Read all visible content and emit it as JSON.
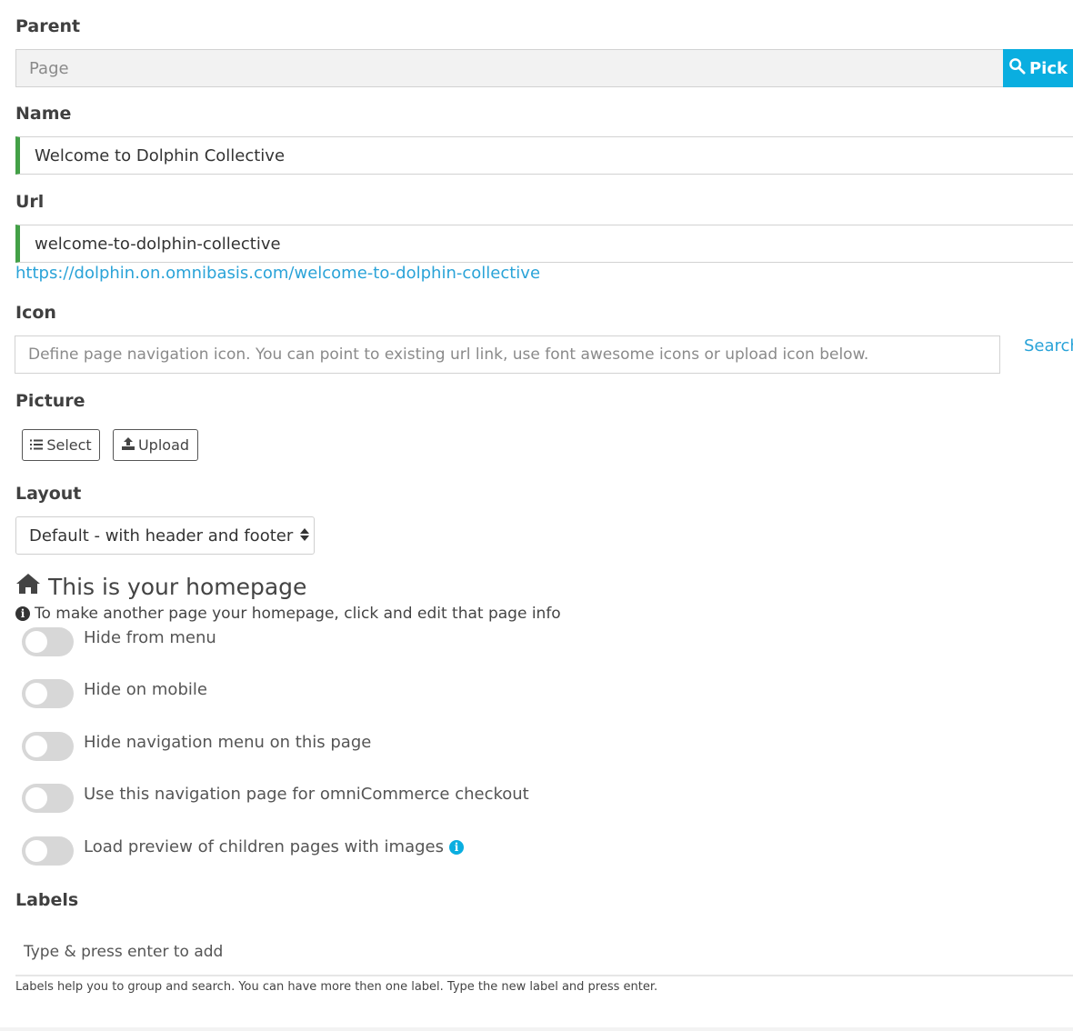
{
  "parent": {
    "label": "Parent",
    "placeholder": "Page",
    "pick_label": "Pick"
  },
  "name": {
    "label": "Name",
    "value": "Welcome to Dolphin Collective"
  },
  "url": {
    "label": "Url",
    "value": "welcome-to-dolphin-collective",
    "link": "https://dolphin.on.omnibasis.com/welcome-to-dolphin-collective"
  },
  "icon": {
    "label": "Icon",
    "placeholder": "Define page navigation icon. You can point to existing url link, use font awesome icons or upload icon below.",
    "search_label": "Search"
  },
  "picture": {
    "label": "Picture",
    "select_label": "Select",
    "upload_label": "Upload"
  },
  "layout": {
    "label": "Layout",
    "selected": "Default - with header and footer"
  },
  "homepage": {
    "title": "This is your homepage",
    "note": "To make another page your homepage, click and edit that page info"
  },
  "toggles": [
    {
      "label": "Hide from menu",
      "on": false
    },
    {
      "label": "Hide on mobile",
      "on": false
    },
    {
      "label": "Hide navigation menu on this page",
      "on": false
    },
    {
      "label": "Use this navigation page for omniCommerce checkout",
      "on": false
    },
    {
      "label": "Load preview of children pages with images",
      "on": false
    }
  ],
  "labels": {
    "label": "Labels",
    "placeholder": "Type & press enter to add",
    "help": "Labels help you to group and search. You can have more then one label. Type the new label and press enter."
  },
  "colors": {
    "accent": "#0aaee0",
    "valid": "#43a047",
    "link": "#2aa3d8"
  },
  "icons": [
    "search-icon",
    "list-icon",
    "upload-icon",
    "sort-icon",
    "home-icon",
    "info-icon"
  ]
}
